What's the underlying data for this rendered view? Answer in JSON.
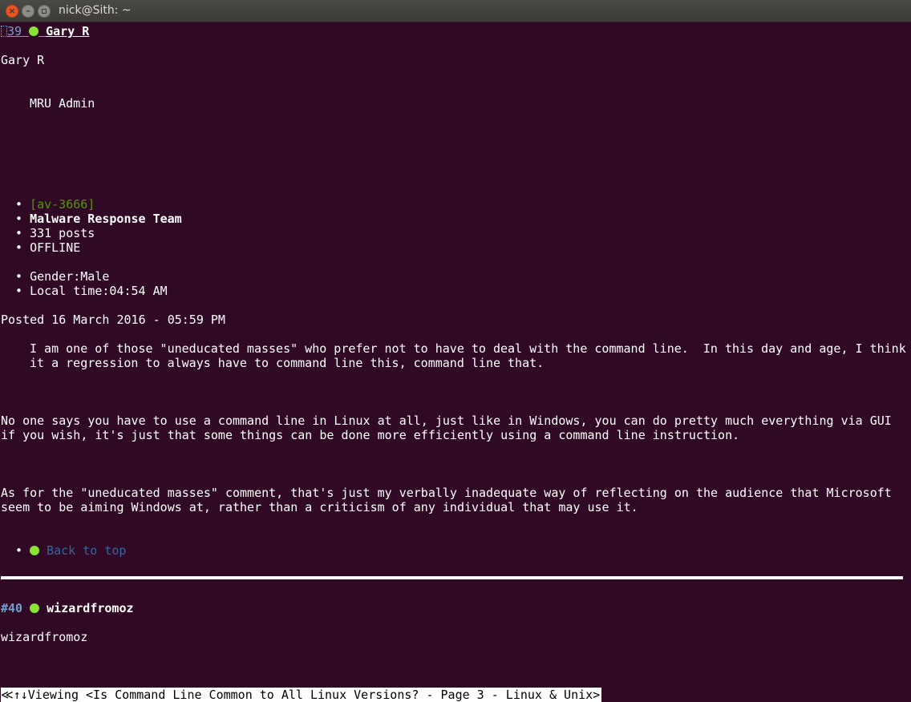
{
  "window": {
    "title": "nick@Sith: ~"
  },
  "post39": {
    "number": "39",
    "author": "Gary R",
    "display_name": "Gary R",
    "role": "MRU Admin",
    "avatar_alt": "[av-3666]",
    "group": "Malware Response Team",
    "posts": "331 posts",
    "status": "OFFLINE",
    "gender": "Gender:Male",
    "local_time": "Local time:04:54 AM",
    "posted": "Posted 16 March 2016 - 05:59 PM",
    "quote_line1": "I am one of those \"uneducated masses\" who prefer not to have to deal with the command line.  In this day and age, I think",
    "quote_line2": "it a regression to always have to command line this, command line that.",
    "para1_line1": "No one says you have to use a command line in Linux at all, just like in Windows, you can do pretty much everything via GUI",
    "para1_line2": "if you wish, it's just that some things can be done more efficiently using a command line instruction.",
    "para2_line1": "As for the \"uneducated masses\" comment, that's just my verbally inadequate way of reflecting on the audience that Microsoft",
    "para2_line2": "seem to be aiming Windows at, rather than a criticism of any individual that may use it.",
    "back_to_top": "Back to top"
  },
  "post40": {
    "number": "#40",
    "author": "wizardfromoz",
    "display_name": "wizardfromoz"
  },
  "statusbar": {
    "text": "≪↑↓Viewing <Is Command Line Common to All Linux Versions? - Page 3 - Linux & Unix>"
  },
  "colors": {
    "background": "#300a24",
    "online_dot": "#8ae234",
    "link": "#729fcf",
    "avatar_text": "#4e9a06"
  },
  "bullet": "•"
}
